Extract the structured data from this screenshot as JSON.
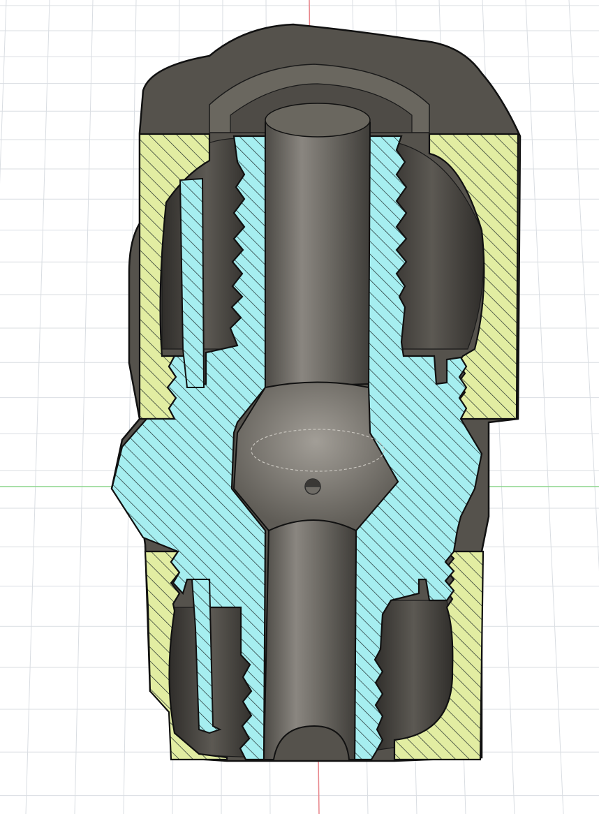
{
  "viewport": {
    "view": "section-analysis",
    "background": "#ffffff",
    "grid_color": "#d9dde2",
    "axis_colors": {
      "vertical_axis": "#e8848a",
      "horizontal_axis": "#8cd68c"
    }
  },
  "model": {
    "body_color": "#5a5751",
    "body_dark": "#3b3934",
    "body_light": "#8a8680",
    "outer_section_hatch": "#e2eda2",
    "inner_section_hatch": "#a6eef0",
    "hatch_line": "#1e2a2a"
  },
  "icons": {
    "origin_marker": "origin-icon"
  }
}
